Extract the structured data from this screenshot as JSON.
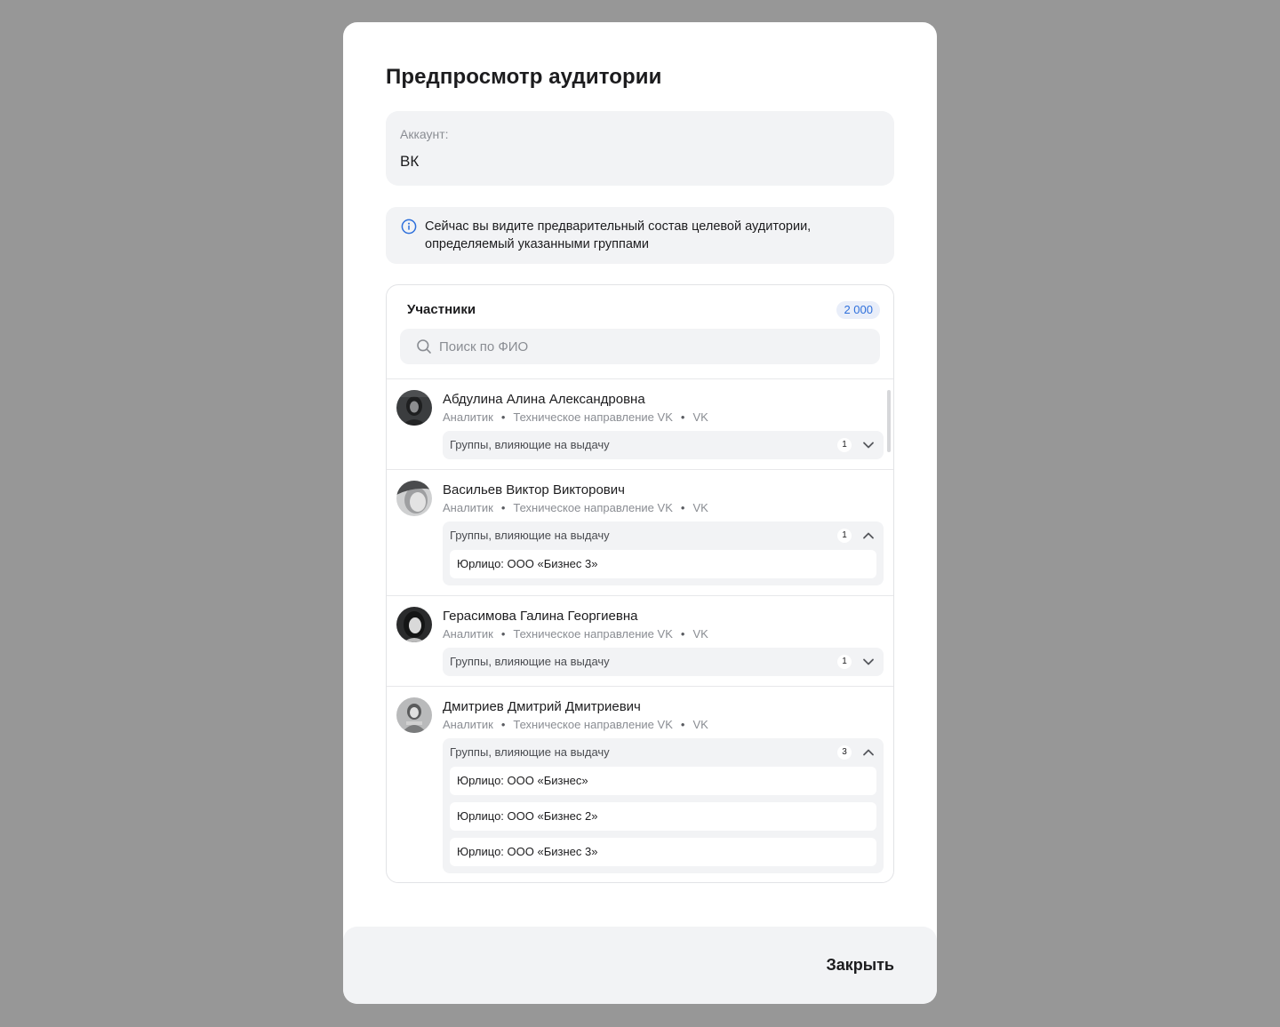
{
  "modal": {
    "title": "Предпросмотр аудитории",
    "account_label": "Аккаунт:",
    "account_value": "ВК",
    "info_text": "Сейчас вы видите предварительный состав целевой аудитории, определяемый указанными группами",
    "info_icon": "info-circle-icon",
    "close_label": "Закрыть"
  },
  "members": {
    "title": "Участники",
    "count": "2 000",
    "search_placeholder": "Поиск по ФИО",
    "groups_label": "Группы, влияющие на выдачу",
    "rows": [
      {
        "name": "Абдулина Алина Александровна",
        "role": "Аналитик",
        "department": "Техническое направление VK",
        "company": "VK",
        "groups_count": "1",
        "expanded": false,
        "groups": []
      },
      {
        "name": "Васильев Виктор Викторович",
        "role": "Аналитик",
        "department": "Техническое направление VK",
        "company": "VK",
        "groups_count": "1",
        "expanded": true,
        "groups": [
          "Юрлицо: ООО «Бизнес 3»"
        ]
      },
      {
        "name": "Герасимова Галина Георгиевна",
        "role": "Аналитик",
        "department": "Техническое направление VK",
        "company": "VK",
        "groups_count": "1",
        "expanded": false,
        "groups": []
      },
      {
        "name": "Дмитриев Дмитрий Дмитриевич",
        "role": "Аналитик",
        "department": "Техническое направление VK",
        "company": "VK",
        "groups_count": "3",
        "expanded": true,
        "groups": [
          "Юрлицо: ООО «Бизнес»",
          "Юрлицо: ООО «Бизнес 2»",
          "Юрлицо: ООО «Бизнес 3»"
        ]
      }
    ]
  },
  "colors": {
    "overlay": "#979797",
    "accent": "#2d6fdb",
    "surface": "#f2f3f5"
  }
}
